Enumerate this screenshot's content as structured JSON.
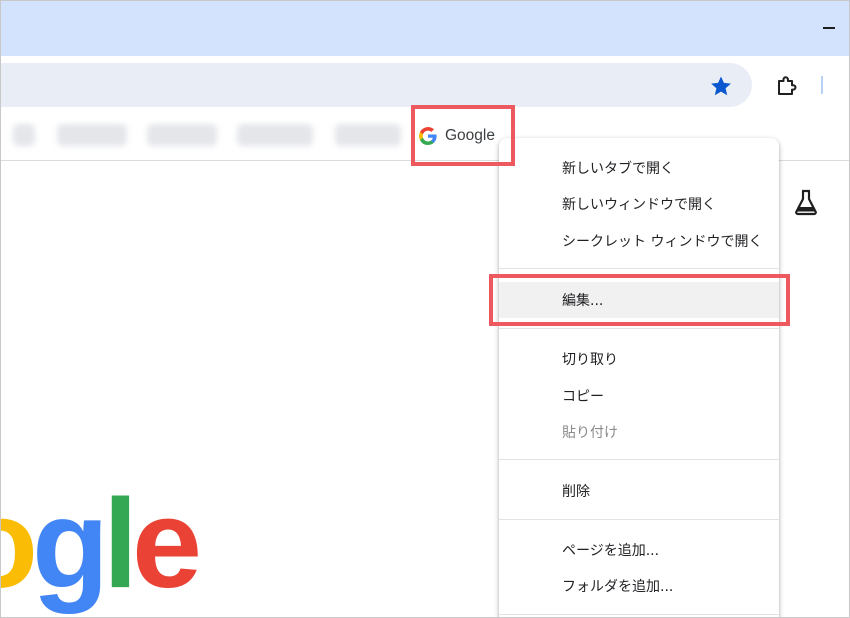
{
  "bookmarks_bar": {
    "google_bookmark_label": "Google"
  },
  "context_menu": {
    "items": [
      {
        "label": "新しいタブで開く",
        "enabled": true
      },
      {
        "label": "新しいウィンドウで開く",
        "enabled": true
      },
      {
        "label": "シークレット ウィンドウで開く",
        "enabled": true
      },
      {
        "label": "編集...",
        "enabled": true,
        "hovered": true
      },
      {
        "label": "切り取り",
        "enabled": true
      },
      {
        "label": "コピー",
        "enabled": true
      },
      {
        "label": "貼り付け",
        "enabled": false
      },
      {
        "label": "削除",
        "enabled": true
      },
      {
        "label": "ページを追加...",
        "enabled": true
      },
      {
        "label": "フォルダを追加...",
        "enabled": true
      }
    ]
  },
  "page": {
    "logo_text_visible": "ogle"
  },
  "icons": {
    "bookmark_star": "star-icon",
    "extensions": "puzzle-icon",
    "labs": "flask-icon",
    "google_favicon": "google-g-icon"
  },
  "colors": {
    "titlebar": "#d3e3fd",
    "omnibox": "#e9eef6",
    "star": "#0b57d0",
    "highlight": "#ec5a5f"
  }
}
